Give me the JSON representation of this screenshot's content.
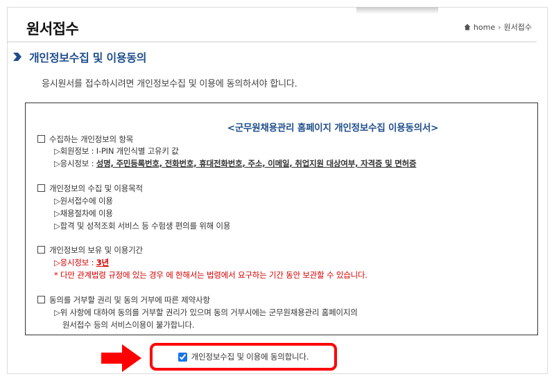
{
  "header": {
    "title": "원서접수",
    "breadcrumb": {
      "home": "home",
      "current": "원서접수"
    }
  },
  "section": {
    "title": "개인정보수집 및 이용동의",
    "intro": "응시원서를 접수하시려면 개인정보수집 및 이용에 동의하셔야 합니다."
  },
  "terms": {
    "title": "<군무원채용관리 홈페이지 개인정보수집 이용동의서>",
    "s1": {
      "heading": "수집하는 개인정보의 항목",
      "l1": "▷회원정보 : I-PIN 개인식별 고유키 값",
      "l2_prefix": "▷응시정보 : ",
      "l2_items": "성명, 주민등록번호, 전화번호, 휴대전화번호, 주소, 이메일, 취업지원 대상여부, 자격증 및 면허증"
    },
    "s2": {
      "heading": "개인정보의 수집 및 이용목적",
      "l1": "▷원서접수에 이용",
      "l2": "▷채용절차에 이용",
      "l3": "▷합격 및 성적조회 서비스 등 수험생 편의를 위해 이용"
    },
    "s3": {
      "heading": "개인정보의 보유 및 이용기간",
      "l1_prefix": "▷응시정보 : ",
      "l1_value": "3년",
      "note": "* 다만 관계법령 규정에 있는 경우 에 한해서는 법령에서 요구하는 기간 동안 보관할 수 있습니다."
    },
    "s4": {
      "heading": "동의를 거부할 권리 및 동의 거부에 따른 제약사항",
      "l1": "▷위 사항에 대하여 동의를 거부할 권리가 있으며 동의 거부시에는 군무원채용관리 홈페이지의",
      "l2": "원서접수 등의 서비스이용이 불가합니다."
    }
  },
  "agree": {
    "label": "개인정보수집 및 이용에 동의합니다.",
    "checked": true
  },
  "colors": {
    "accent": "#1f4e8c",
    "highlight": "#ff0000",
    "warning": "#d40000"
  }
}
